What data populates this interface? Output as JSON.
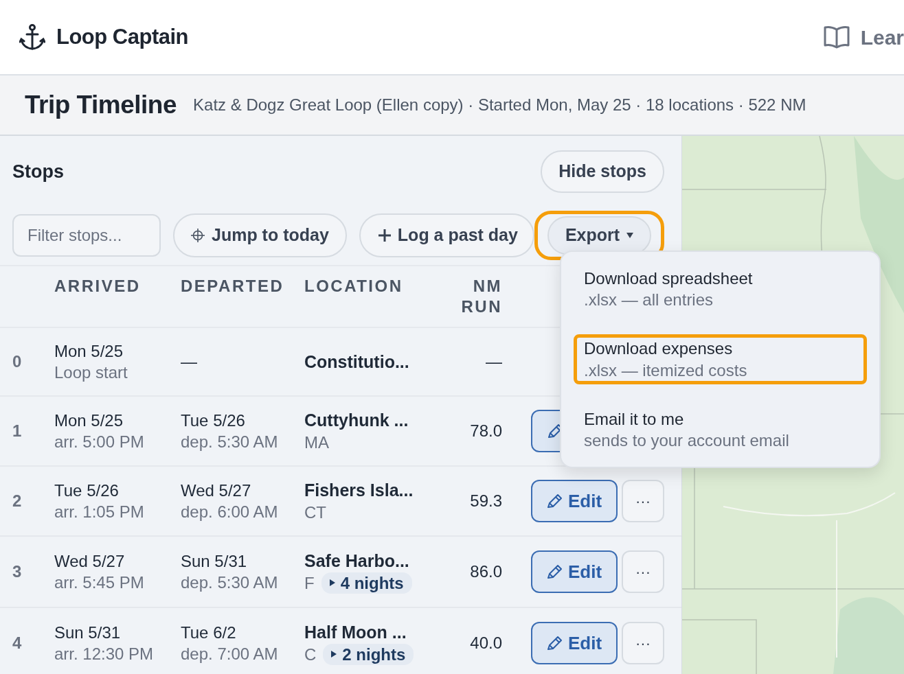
{
  "app": {
    "brand": "Loop Captain",
    "nav_link": "Lear"
  },
  "page": {
    "title": "Trip Timeline",
    "subtitle": "Katz & Dogz Great Loop (Ellen copy) · Started Mon, May 25 · 18 locations · 522 NM"
  },
  "stops_panel": {
    "heading": "Stops",
    "hide_button": "Hide stops",
    "filter": {
      "placeholder": "Filter stops..."
    },
    "jump_button": "Jump to today",
    "log_button": "Log a past day",
    "export_button": {
      "label": "Export",
      "expanded": true,
      "highlighted": true
    }
  },
  "table": {
    "columns": [
      "ARRIVED",
      "DEPARTED",
      "LOCATION",
      "NM RUN"
    ],
    "rows": [
      {
        "index": "0",
        "arrived": "Mon 5/25",
        "arrived_sub": "Loop start",
        "departed": "—",
        "location": "Constitutio...",
        "nm": "—"
      },
      {
        "index": "1",
        "arrived": "Mon 5/25",
        "arrived_sub": "arr. 5:00 PM",
        "departed": "Tue 5/26",
        "departed_sub": "dep. 5:30 AM",
        "location": "Cuttyhunk ...",
        "location_sub": "MA",
        "nm": "78.0",
        "edit_icon": true
      },
      {
        "index": "2",
        "arrived": "Tue 5/26",
        "arrived_sub": "arr. 1:05 PM",
        "departed": "Wed 5/27",
        "departed_sub": "dep. 6:00 AM",
        "location": "Fishers Isla...",
        "location_sub": "CT",
        "nm": "59.3",
        "edit": "Edit",
        "more": "···"
      },
      {
        "index": "3",
        "arrived": "Wed 5/27",
        "arrived_sub": "arr. 5:45 PM",
        "departed": "Sun 5/31",
        "departed_sub": "dep. 5:30 AM",
        "location": "Safe Harbo...",
        "location_sub": "F",
        "nights": "4 nights",
        "nm": "86.0",
        "edit": "Edit",
        "more": "···"
      },
      {
        "index": "4",
        "arrived": "Sun 5/31",
        "arrived_sub": "arr. 12:30 PM",
        "departed": "Tue 6/2",
        "departed_sub": "dep. 7:00 AM",
        "location": "Half Moon ...",
        "location_sub": "C",
        "nights": "2 nights",
        "nm": "40.0",
        "edit": "Edit",
        "more": "···"
      }
    ]
  },
  "export_menu": {
    "items": [
      {
        "title": "Download spreadsheet",
        "detail": ".xlsx — all entries",
        "highlighted": false
      },
      {
        "title": "Download expenses",
        "detail": ".xlsx — itemized costs",
        "highlighted": true
      },
      {
        "title": "Email it to me",
        "detail": "sends to your account email",
        "highlighted": false
      }
    ]
  }
}
